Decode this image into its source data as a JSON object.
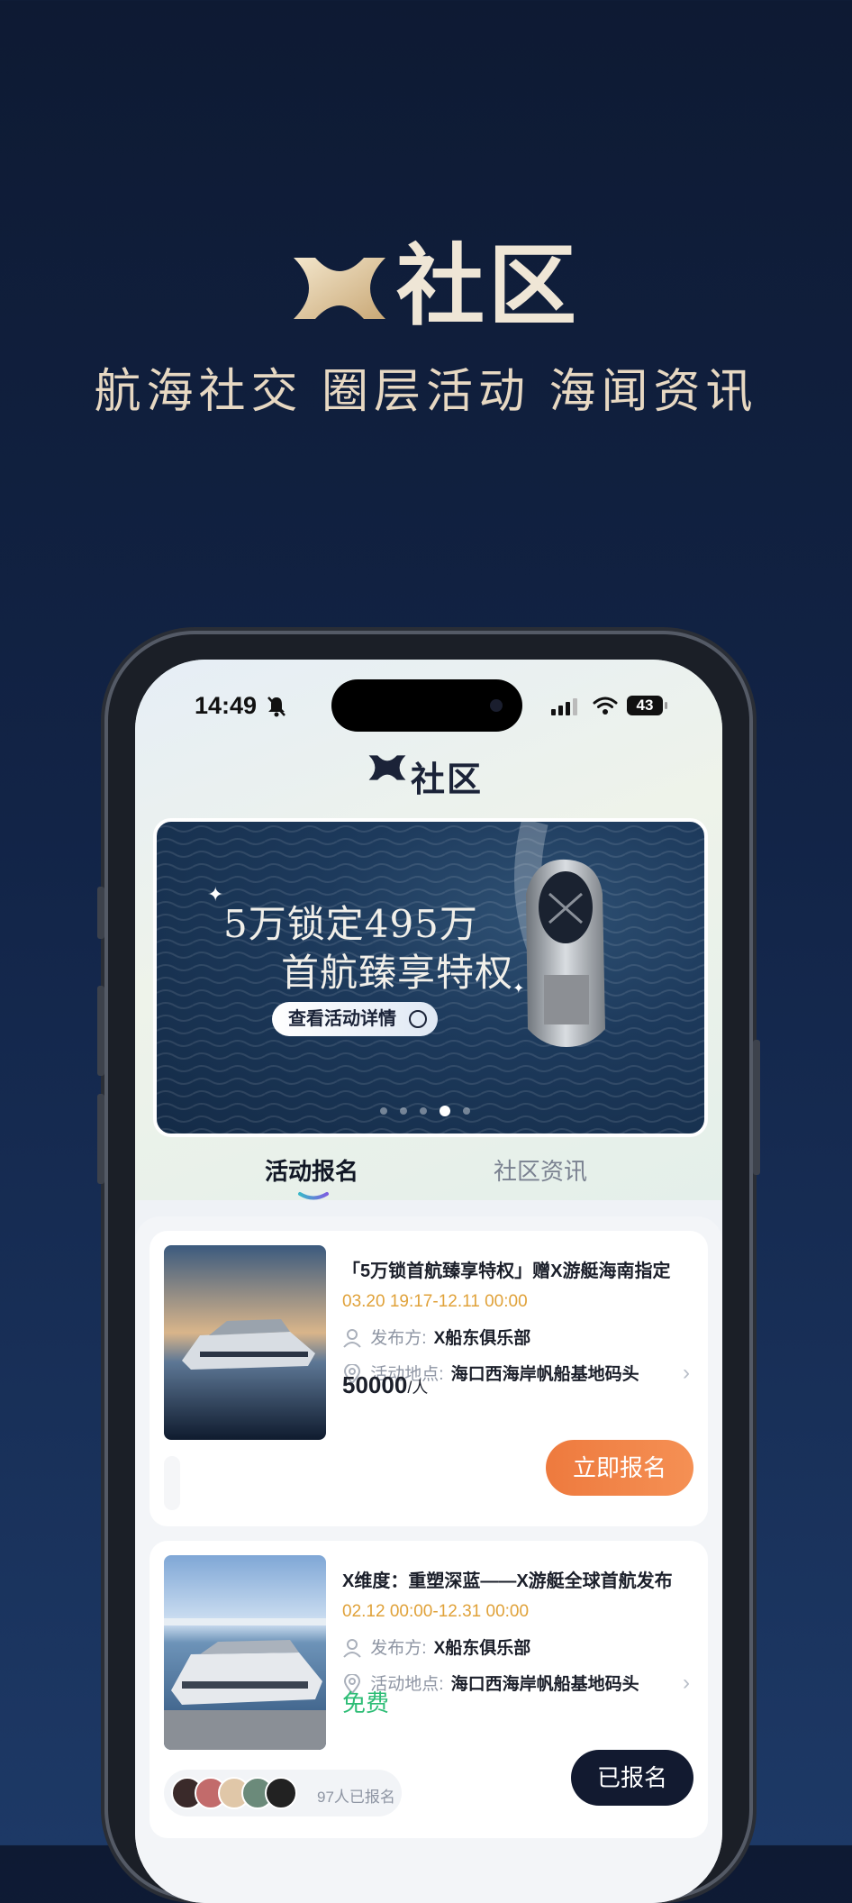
{
  "hero": {
    "brand_text": "社区",
    "tagline": "航海社交 圈层活动 海闻资讯"
  },
  "status_bar": {
    "time": "14:49",
    "battery": "43"
  },
  "app": {
    "logo_text": "社区"
  },
  "banner": {
    "title_line1": "5万锁定495万",
    "title_line2": "首航臻享特权",
    "button_label": "查看活动详情",
    "slide_count": 4,
    "active_slide": 3
  },
  "tabs": [
    {
      "label": "活动报名",
      "active": true
    },
    {
      "label": "社区资讯",
      "active": false
    }
  ],
  "events": [
    {
      "title": "「5万锁首航臻享特权」赠X游艇海南指定",
      "time": "03.20 19:17-12.11 00:00",
      "publisher_label": "发布方:",
      "publisher": "X船东俱乐部",
      "location_label": "活动地点:",
      "location": "海口西海岸帆船基地码头",
      "price": "50000",
      "price_unit": "/人",
      "button": "立即报名"
    },
    {
      "title": "X维度：重塑深蓝——X游艇全球首航发布",
      "time": "02.12 00:00-12.31 00:00",
      "publisher_label": "发布方:",
      "publisher": "X船东俱乐部",
      "location_label": "活动地点:",
      "location": "海口西海岸帆船基地码头",
      "price": "免费",
      "button": "已报名",
      "signed_text": "97人已报名"
    }
  ],
  "colors": {
    "accent_orange": "#ee7a3e",
    "time_gold": "#e0a23a",
    "free_green": "#2ebd76",
    "navy": "#121a30"
  }
}
